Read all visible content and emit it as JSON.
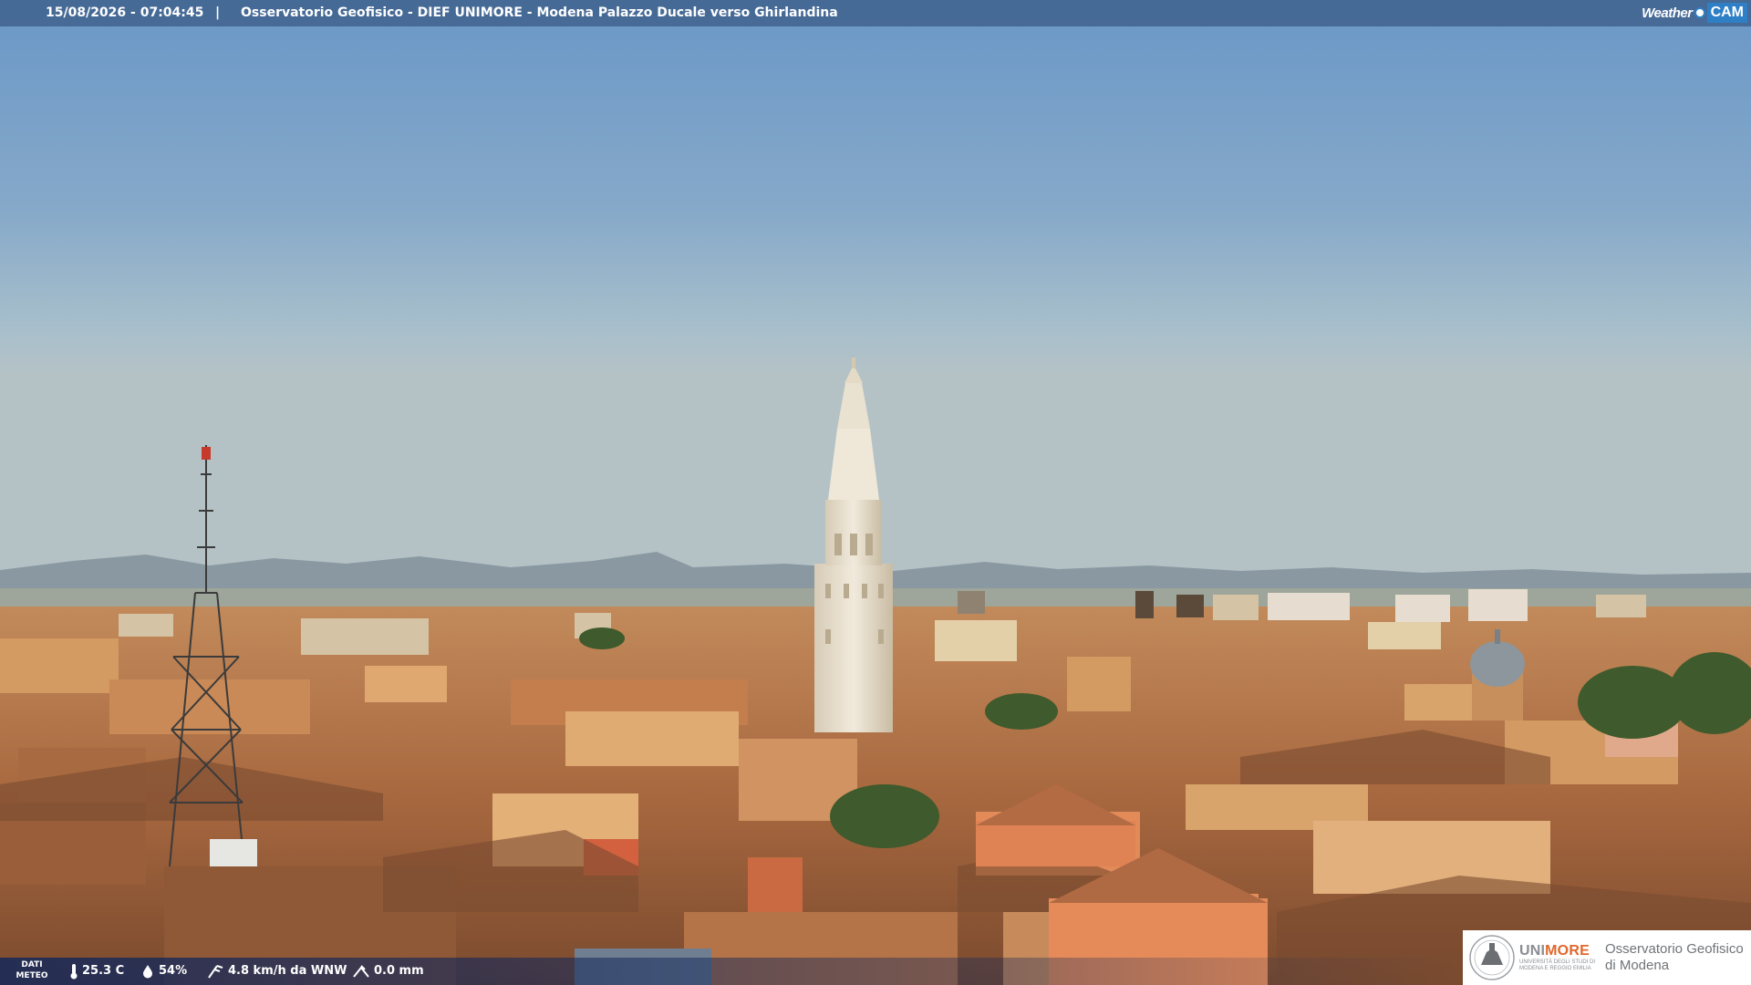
{
  "header": {
    "timestamp": "15/08/2026 - 07:04:45",
    "separator": "|",
    "caption": "Osservatorio Geofisico - DIEF UNIMORE - Modena Palazzo Ducale verso Ghirlandina",
    "brand_weather": "Weather",
    "brand_cam": "CAM"
  },
  "weather": {
    "label_line1": "DATI",
    "label_line2": "METEO",
    "temperature": "25.3 C",
    "humidity": "54%",
    "wind": "4.8 km/h da WNW",
    "rain": "0.0 mm",
    "icons": [
      "thermometer-icon",
      "humidity-drop-icon",
      "wind-icon",
      "rain-gauge-icon"
    ]
  },
  "logo": {
    "uni_prefix": "UNI",
    "uni_suffix": "MORE",
    "uni_subtitle_line1": "Università degli studi di",
    "uni_subtitle_line2": "Modena e Reggio Emilia",
    "observatory_line1": "Osservatorio Geofisico",
    "observatory_line2": "di Modena"
  },
  "colors": {
    "sky_top": "#6d9ac8",
    "sky_horizon": "#b4c4c8",
    "roof": "#b86f43",
    "tower": "#e9e0cf",
    "unimore_orange": "#e0682b",
    "weathercam_blue": "#2f7fc6"
  }
}
